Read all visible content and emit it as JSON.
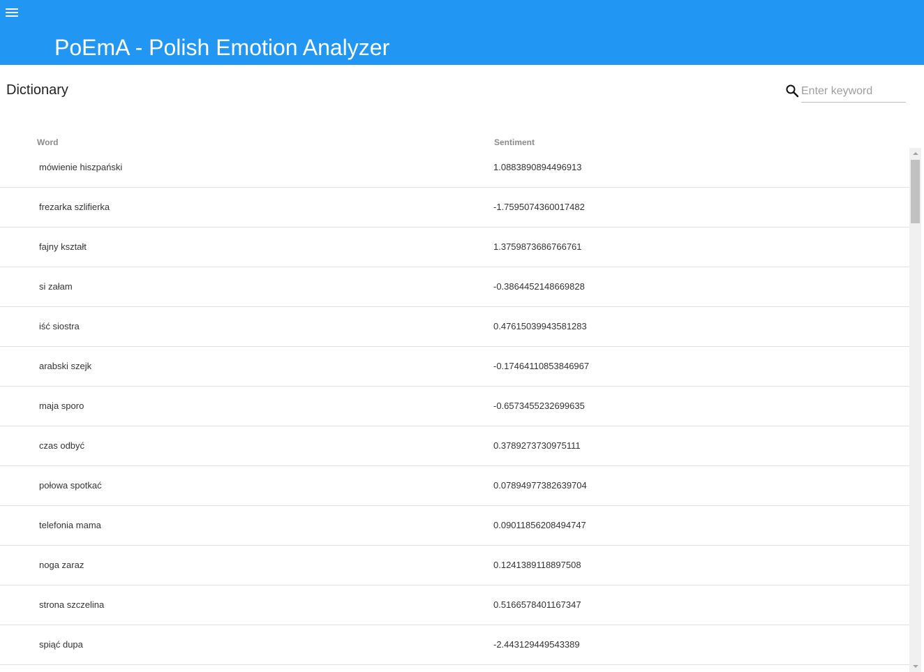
{
  "header": {
    "title": "PoEmA - Polish Emotion Analyzer",
    "menu_icon": "hamburger-menu-icon",
    "background": "#2196f3"
  },
  "dictionary": {
    "title": "Dictionary",
    "search": {
      "icon": "search-icon",
      "placeholder": "Enter keyword",
      "value": ""
    },
    "columns": {
      "word": "Word",
      "sentiment": "Sentiment"
    },
    "rows": [
      {
        "word": "mówienie hiszpański",
        "sentiment": "1.0883890894496913"
      },
      {
        "word": "frezarka szlifierka",
        "sentiment": "-1.7595074360017482"
      },
      {
        "word": "fajny kształt",
        "sentiment": "1.3759873686766761"
      },
      {
        "word": "si załam",
        "sentiment": "-0.3864452148669828"
      },
      {
        "word": "iść siostra",
        "sentiment": "0.47615039943581283"
      },
      {
        "word": "arabski szejk",
        "sentiment": "-0.17464110853846967"
      },
      {
        "word": "maja sporo",
        "sentiment": "-0.6573455232699635"
      },
      {
        "word": "czas odbyć",
        "sentiment": "0.3789273730975111"
      },
      {
        "word": "połowa spotkać",
        "sentiment": "0.07894977382639704"
      },
      {
        "word": "telefonia mama",
        "sentiment": "0.09011856208494747"
      },
      {
        "word": "noga zaraz",
        "sentiment": "0.1241389118897508"
      },
      {
        "word": "strona szczelina",
        "sentiment": "0.5166578401167347"
      },
      {
        "word": "spiąć dupa",
        "sentiment": "-2.443129449543389"
      }
    ]
  }
}
